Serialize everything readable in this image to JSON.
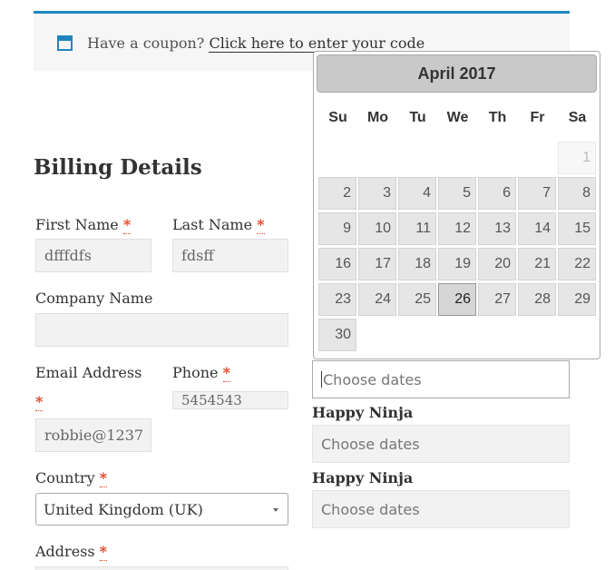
{
  "coupon": {
    "prompt": "Have a coupon?",
    "link": "Click here to enter your code"
  },
  "billing": {
    "title": "Billing Details",
    "required_mark": "*",
    "first_name": {
      "label": "First Name",
      "value": "dfffdfs"
    },
    "last_name": {
      "label": "Last Name",
      "value": "fdsff"
    },
    "company": {
      "label": "Company Name",
      "value": ""
    },
    "email": {
      "label": "Email Address",
      "value": "robbie@1237"
    },
    "phone": {
      "label": "Phone",
      "value": "5454543"
    },
    "country": {
      "label": "Country",
      "value": "United Kingdom (UK)"
    },
    "address": {
      "label": "Address"
    }
  },
  "booking": {
    "placeholder": "Choose dates",
    "product_name": "Happy Ninja"
  },
  "datepicker": {
    "title": "April 2017",
    "weekdays": [
      "Su",
      "Mo",
      "Tu",
      "We",
      "Th",
      "Fr",
      "Sa"
    ],
    "weeks": [
      [
        "",
        "",
        "",
        "",
        "",
        "",
        "1"
      ],
      [
        "2",
        "3",
        "4",
        "5",
        "6",
        "7",
        "8"
      ],
      [
        "9",
        "10",
        "11",
        "12",
        "13",
        "14",
        "15"
      ],
      [
        "16",
        "17",
        "18",
        "19",
        "20",
        "21",
        "22"
      ],
      [
        "23",
        "24",
        "25",
        "26",
        "27",
        "28",
        "29"
      ],
      [
        "30",
        "",
        "",
        "",
        "",
        "",
        ""
      ]
    ],
    "disabled_days": [
      "1"
    ],
    "highlighted_day": "26"
  },
  "colors": {
    "accent": "#1e85be",
    "required": "#e2401c"
  }
}
